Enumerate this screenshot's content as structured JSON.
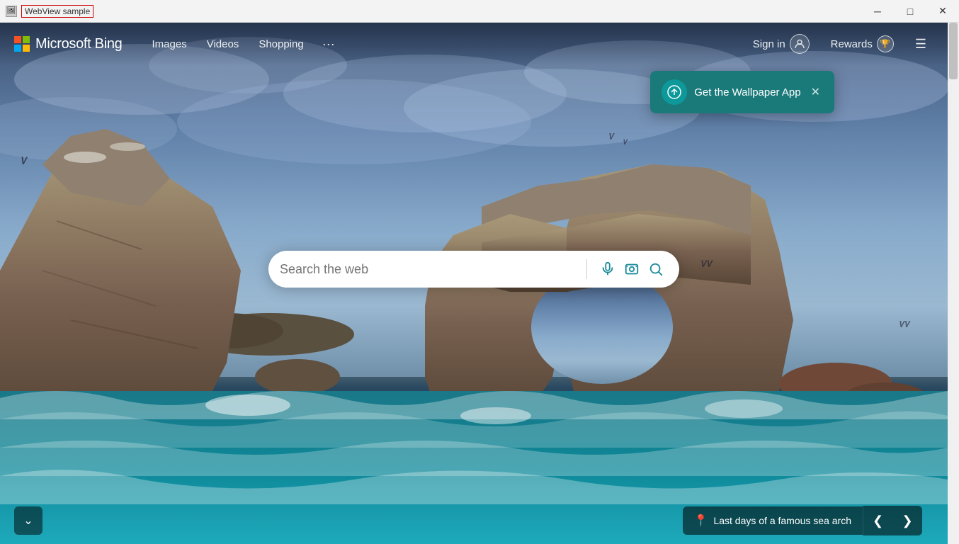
{
  "titleBar": {
    "title": "WebView sample",
    "minimizeLabel": "─",
    "maximizeLabel": "□",
    "closeLabel": "✕"
  },
  "navbar": {
    "logoText": "Microsoft Bing",
    "links": [
      {
        "label": "Images",
        "id": "images"
      },
      {
        "label": "Videos",
        "id": "videos"
      },
      {
        "label": "Shopping",
        "id": "shopping"
      }
    ],
    "dotsLabel": "···",
    "signInLabel": "Sign in",
    "rewardsLabel": "Rewards",
    "menuLabel": "☰"
  },
  "wallpaperPopup": {
    "title": "Get the Wallpaper App",
    "closeLabel": "✕"
  },
  "searchBar": {
    "placeholder": "Search the web",
    "micTooltip": "Search by voice",
    "visualSearchTooltip": "Search by image",
    "searchTooltip": "Search"
  },
  "bottomBar": {
    "scrollDownLabel": "⌄",
    "caption": "Last days of a famous sea arch",
    "prevLabel": "❮",
    "nextLabel": "❯"
  }
}
